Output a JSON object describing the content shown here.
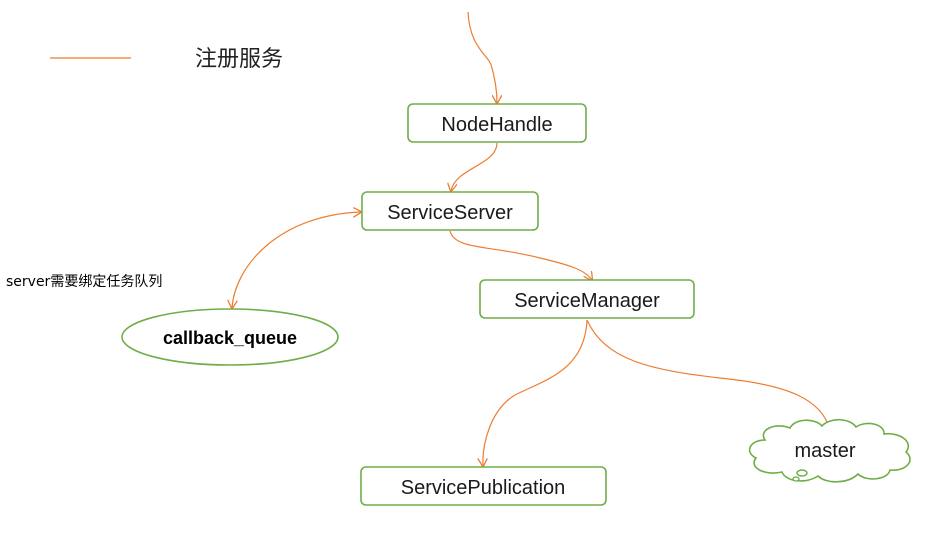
{
  "colors": {
    "edge": "#ed7d31",
    "node_border": "#70ad47",
    "text": "#1a1a1a"
  },
  "legend": {
    "label": "注册服务"
  },
  "note": {
    "text": "server需要绑定任务队列"
  },
  "nodes": {
    "node_handle": "NodeHandle",
    "service_server": "ServiceServer",
    "service_manager": "ServiceManager",
    "service_publication": "ServicePublication",
    "callback_queue": "callback_queue",
    "master": "master"
  }
}
